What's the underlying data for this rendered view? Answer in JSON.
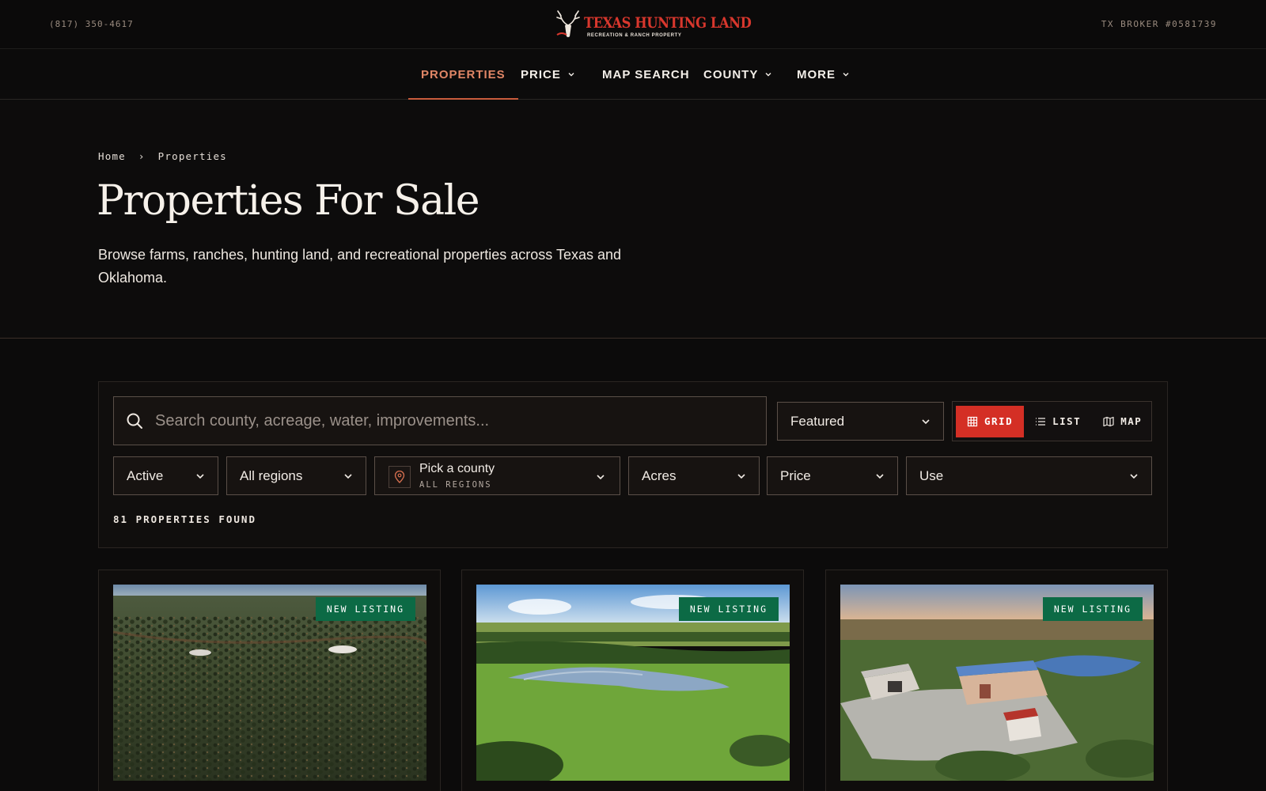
{
  "topbar": {
    "phone": "(817) 350-4617",
    "broker": "TX BROKER #0581739",
    "logo_text": "TEXAS HUNTING LAND",
    "logo_tagline": "RECREATION & RANCH PROPERTY"
  },
  "nav": {
    "items": [
      {
        "label": "PROPERTIES",
        "active": true
      },
      {
        "label": "PRICE",
        "dropdown": true
      },
      {
        "label": "MAP SEARCH"
      },
      {
        "label": "COUNTY",
        "dropdown": true
      },
      {
        "label": "MORE",
        "dropdown": true
      }
    ]
  },
  "breadcrumb": {
    "home": "Home",
    "separator": "›",
    "current": "Properties"
  },
  "hero": {
    "title": "Properties For Sale",
    "description": "Browse farms, ranches, hunting land, and recreational properties across Texas and Oklahoma."
  },
  "filters": {
    "search_placeholder": "Search county, acreage, water, improvements...",
    "sort": "Featured",
    "view_modes": [
      {
        "label": "GRID",
        "icon": "grid-icon",
        "active": true
      },
      {
        "label": "LIST",
        "icon": "list-icon"
      },
      {
        "label": "MAP",
        "icon": "map-icon"
      }
    ],
    "status": "Active",
    "region": "All regions",
    "county_label": "Pick a county",
    "county_sub": "ALL REGIONS",
    "acres": "Acres",
    "price": "Price",
    "use": "Use"
  },
  "results": {
    "count_text": "81 PROPERTIES FOUND"
  },
  "cards": [
    {
      "badge": "NEW LISTING",
      "scene": "brushland-aerial"
    },
    {
      "badge": "NEW LISTING",
      "scene": "pond-meadow"
    },
    {
      "badge": "NEW LISTING",
      "scene": "ranch-buildings-lake"
    }
  ],
  "colors": {
    "background": "#0c0b0b",
    "accent_red": "#d42f25",
    "nav_active": "#e08666",
    "badge_green": "#0c6a45",
    "logo_red": "#d8372d"
  }
}
